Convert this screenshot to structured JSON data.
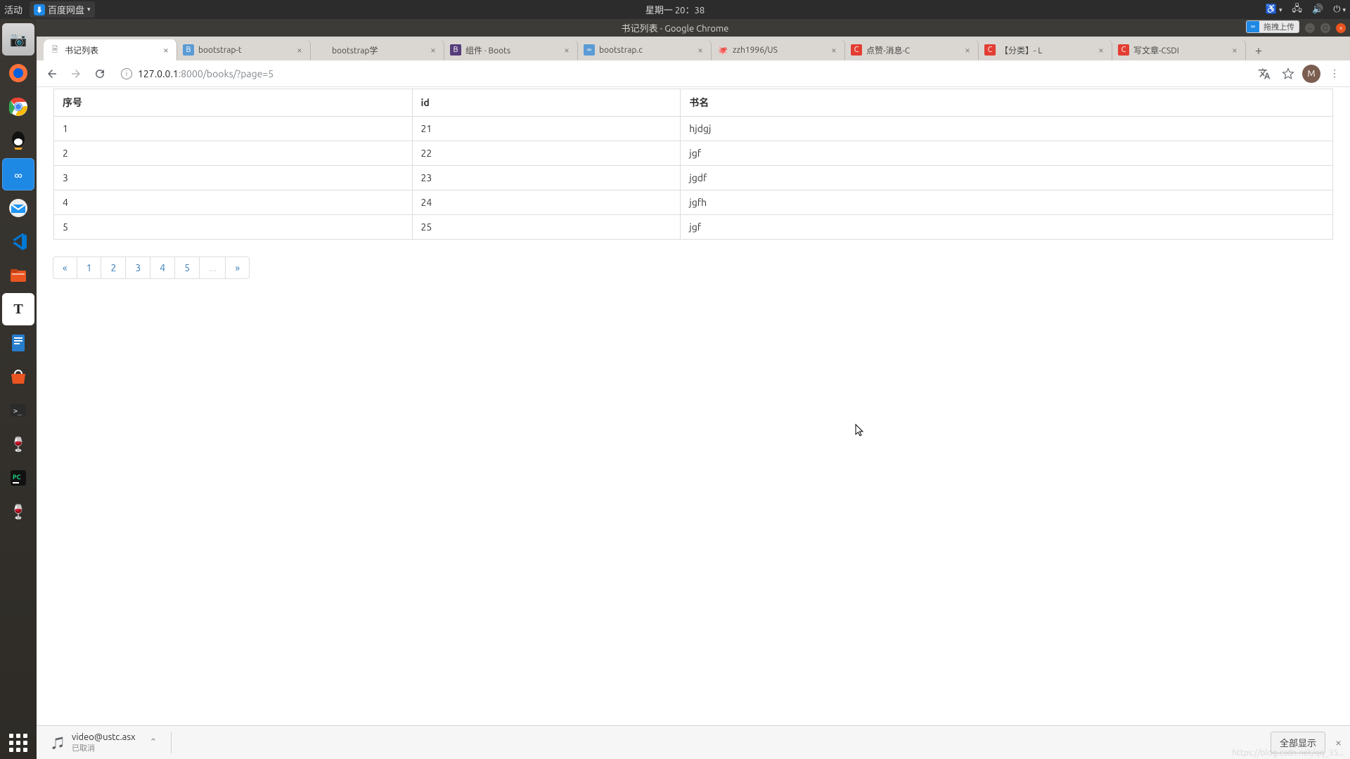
{
  "gnome": {
    "activities": "活动",
    "app_menu": "百度网盘",
    "clock": "星期一 20：38"
  },
  "chrome_title": "书记列表 - Google Chrome",
  "upload_badge": "拖拽上传",
  "tabs": [
    {
      "title": "书记列表",
      "active": true,
      "favicon": "doc"
    },
    {
      "title": "bootstrap-t",
      "favicon": "bs-blue"
    },
    {
      "title": "bootstrap学",
      "favicon": "none"
    },
    {
      "title": "组件 · Boots",
      "favicon": "B"
    },
    {
      "title": "bootstrap.c",
      "favicon": "bs-blue"
    },
    {
      "title": "zzh1996/US",
      "favicon": "gh"
    },
    {
      "title": "点赞-消息-C",
      "favicon": "C"
    },
    {
      "title": "【分类】- L",
      "favicon": "C"
    },
    {
      "title": "写文章-CSDI",
      "favicon": "C"
    }
  ],
  "address": {
    "host": "127.0.0.1",
    "port": ":8000",
    "path": "/books/?page=5"
  },
  "avatar_letter": "M",
  "table": {
    "headers": [
      "序号",
      "id",
      "书名"
    ],
    "rows": [
      [
        "1",
        "21",
        "hjdgj"
      ],
      [
        "2",
        "22",
        "jgf"
      ],
      [
        "3",
        "23",
        "jgdf"
      ],
      [
        "4",
        "24",
        "jgfh"
      ],
      [
        "5",
        "25",
        "jgf"
      ]
    ]
  },
  "pagination": {
    "prev": "«",
    "pages": [
      "1",
      "2",
      "3",
      "4",
      "5"
    ],
    "ellipsis": "...",
    "next": "»"
  },
  "download": {
    "filename": "video@ustc.asx",
    "status": "已取消",
    "show_all": "全部显示"
  },
  "watermark": "https://blog.csdn.net/qq_35...",
  "dock_items": [
    "camera",
    "firefox",
    "chrome",
    "qq",
    "baidupan",
    "mail",
    "vscode",
    "files",
    "typora",
    "writer",
    "store",
    "terminal",
    "wine",
    "pycharm",
    "wine2"
  ]
}
